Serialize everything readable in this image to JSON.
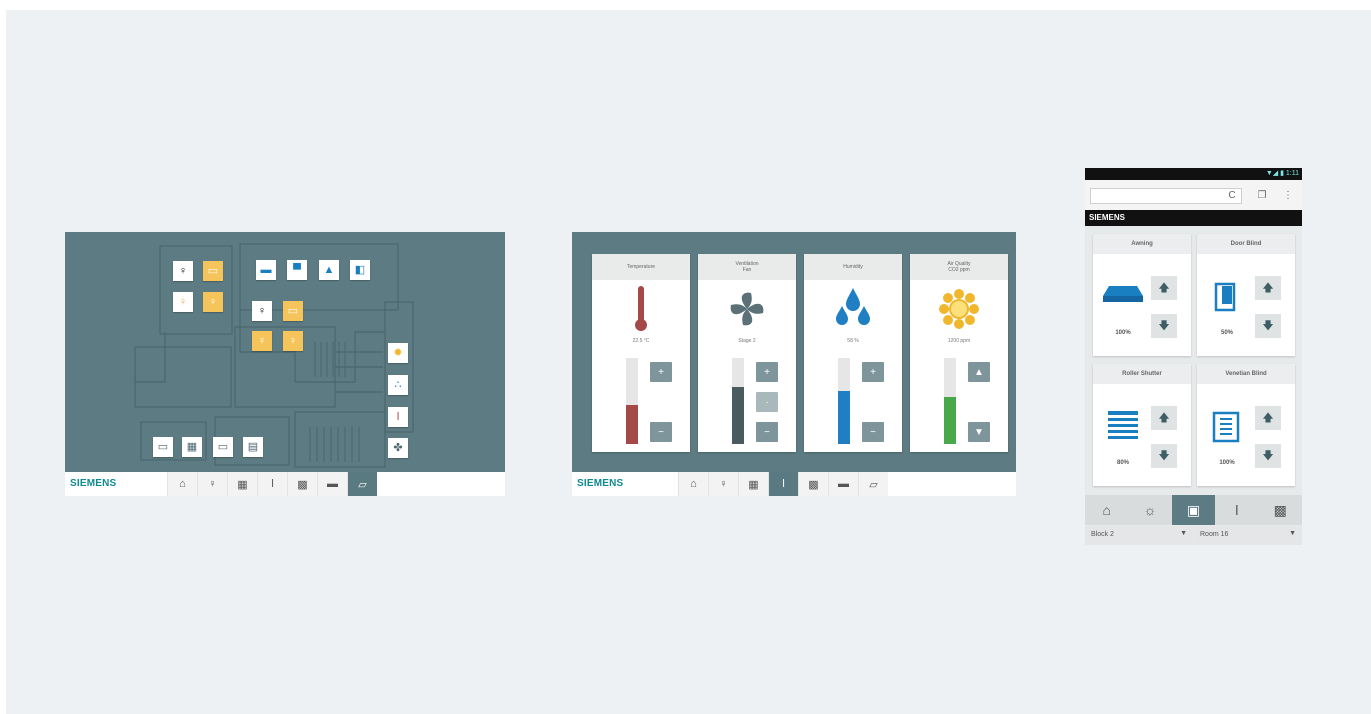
{
  "brand": "SIEMENS",
  "colors": {
    "background": "#eef1f3",
    "panel": "#5d7b83",
    "accent_orange": "#f5c45a",
    "siemens_teal": "#0f8a91",
    "nav_active": "#5a7a82"
  },
  "floorplan": {
    "device_icons": [
      "bulb-icon",
      "dimmer-icon",
      "bulb-icon",
      "bulb-icon",
      "screen-icon",
      "awning-icon",
      "ceiling-light-icon",
      "window-icon",
      "bulb-icon",
      "dimmer-icon",
      "bulb-icon",
      "bulb-icon",
      "sun-icon",
      "drops-icon",
      "thermometer-icon",
      "fan-icon",
      "monitor-icon",
      "panel-icon",
      "monitor-icon",
      "calendar-icon"
    ],
    "nav": [
      "home-icon",
      "light-icon",
      "blinds-icon",
      "thermometer-icon",
      "scene-icon",
      "media-icon",
      "floorplan-icon"
    ],
    "nav_active": 6
  },
  "climate": {
    "cards": [
      {
        "title1": "Temperature",
        "title2": "",
        "value": "22.5 °C",
        "level": 0.45,
        "color": "#a44848",
        "mode": "pm"
      },
      {
        "title1": "Ventilation",
        "title2": "Fan",
        "value": "Stage 2",
        "level": 0.66,
        "color": "#4a5b60",
        "mode": "pm3"
      },
      {
        "title1": "Humidity",
        "title2": "",
        "value": "58 %",
        "level": 0.62,
        "color": "#1f7fc2",
        "mode": "pm"
      },
      {
        "title1": "Air Quality",
        "title2": "CO2 ppm",
        "value": "1200 ppm",
        "level": 0.55,
        "color": "#49a84a",
        "mode": "ud"
      }
    ],
    "nav": [
      "home-icon",
      "light-icon",
      "blinds-icon",
      "thermometer-icon",
      "scene-icon",
      "media-icon",
      "floorplan-icon"
    ],
    "nav_active": 3
  },
  "phone": {
    "status_text": "▼◢ ▮ 1:11",
    "url_reload": "C",
    "cards": [
      {
        "title": "Awning",
        "percent": "100%"
      },
      {
        "title": "Door Blind",
        "percent": "50%"
      },
      {
        "title": "Roller Shutter",
        "percent": "80%"
      },
      {
        "title": "Venetian Blind",
        "percent": "100%"
      }
    ],
    "nav": [
      "home-icon",
      "light-icon",
      "blinds-icon",
      "thermometer-icon",
      "scene-icon"
    ],
    "nav_active": 2,
    "select_block": "Block 2",
    "select_room": "Room 16"
  }
}
